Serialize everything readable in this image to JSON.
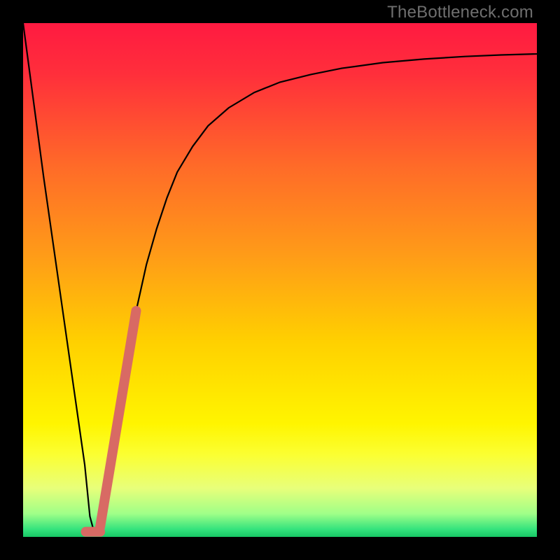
{
  "attribution": "TheBottleneck.com",
  "chart_data": {
    "type": "line",
    "title": "",
    "xlabel": "",
    "ylabel": "",
    "xlim": [
      0,
      100
    ],
    "ylim": [
      0,
      100
    ],
    "grid": false,
    "legend": false,
    "gradient_stops": [
      {
        "offset": 0.0,
        "color": "#ff1a41"
      },
      {
        "offset": 0.1,
        "color": "#ff2f3b"
      },
      {
        "offset": 0.28,
        "color": "#ff6b28"
      },
      {
        "offset": 0.45,
        "color": "#ff9b18"
      },
      {
        "offset": 0.62,
        "color": "#ffd000"
      },
      {
        "offset": 0.78,
        "color": "#fff500"
      },
      {
        "offset": 0.84,
        "color": "#fbff32"
      },
      {
        "offset": 0.905,
        "color": "#e8ff7a"
      },
      {
        "offset": 0.955,
        "color": "#9fff88"
      },
      {
        "offset": 0.985,
        "color": "#35e37d"
      },
      {
        "offset": 1.0,
        "color": "#17c765"
      }
    ],
    "series": [
      {
        "name": "bottleneck-curve",
        "stroke": "#000000",
        "stroke_width": 2.2,
        "x": [
          0.0,
          2.0,
          4.0,
          6.0,
          8.0,
          10.0,
          12.0,
          13.0,
          13.8,
          15.0,
          16.5,
          18.0,
          20.0,
          22.0,
          24.0,
          26.0,
          28.0,
          30.0,
          33.0,
          36.0,
          40.0,
          45.0,
          50.0,
          56.0,
          62.0,
          70.0,
          78.0,
          86.0,
          93.0,
          100.0
        ],
        "values": [
          100.0,
          85.0,
          70.0,
          56.0,
          42.0,
          28.0,
          14.0,
          4.0,
          1.0,
          2.0,
          8.0,
          18.0,
          32.0,
          44.0,
          53.0,
          60.0,
          66.0,
          71.0,
          76.0,
          80.0,
          83.5,
          86.5,
          88.5,
          90.0,
          91.2,
          92.3,
          93.0,
          93.5,
          93.8,
          94.0
        ]
      }
    ],
    "highlight_segment": {
      "name": "highlight-stroke",
      "stroke": "#d86a64",
      "stroke_width": 14,
      "x_start": 15.0,
      "x_end": 22.0,
      "y_start": 2.0,
      "y_end": 44.0
    },
    "minimum_marker": {
      "name": "minimum-marker",
      "stroke": "#d86a64",
      "stroke_width": 14,
      "x_start": 12.2,
      "x_end": 15.0,
      "y": 1.0
    }
  }
}
